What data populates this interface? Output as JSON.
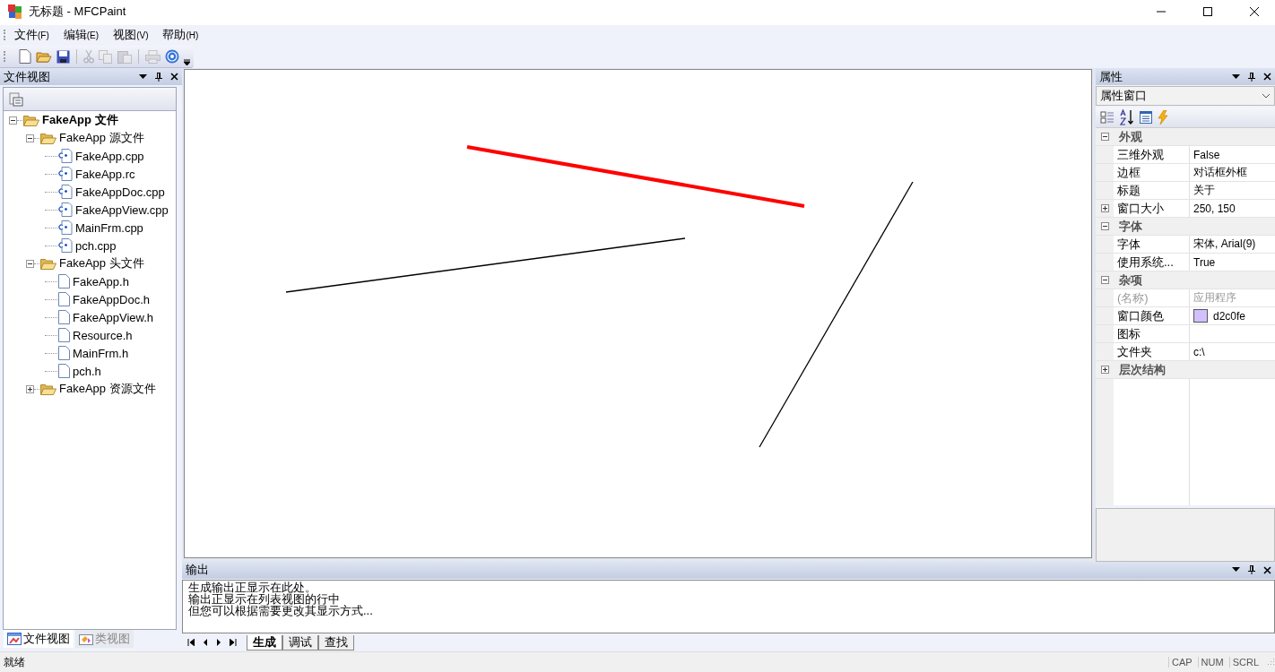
{
  "window": {
    "title": "无标题 - MFCPaint"
  },
  "menu": [
    {
      "label": "文件",
      "key": "(F)"
    },
    {
      "label": "编辑",
      "key": "(E)"
    },
    {
      "label": "视图",
      "key": "(V)"
    },
    {
      "label": "帮助",
      "key": "(H)"
    }
  ],
  "toolbar": [
    {
      "kind": "new",
      "disabled": false
    },
    {
      "kind": "open",
      "disabled": false
    },
    {
      "kind": "save",
      "disabled": false
    },
    {
      "kind": "cut",
      "disabled": true
    },
    {
      "kind": "copy",
      "disabled": true
    },
    {
      "kind": "paste",
      "disabled": true
    },
    {
      "kind": "print",
      "disabled": true
    },
    {
      "kind": "help",
      "disabled": false
    }
  ],
  "file_view": {
    "title": "文件视图",
    "tree": [
      {
        "label": "FakeApp 文件",
        "kind": "folder",
        "expanded": true,
        "children": [
          {
            "label": "FakeApp 源文件",
            "kind": "folder",
            "expanded": true,
            "children": [
              {
                "label": "FakeApp.cpp",
                "kind": "cpp"
              },
              {
                "label": "FakeApp.rc",
                "kind": "cpp"
              },
              {
                "label": "FakeAppDoc.cpp",
                "kind": "cpp"
              },
              {
                "label": "FakeAppView.cpp",
                "kind": "cpp"
              },
              {
                "label": "MainFrm.cpp",
                "kind": "cpp"
              },
              {
                "label": "pch.cpp",
                "kind": "cpp"
              }
            ]
          },
          {
            "label": "FakeApp 头文件",
            "kind": "folder",
            "expanded": true,
            "children": [
              {
                "label": "FakeApp.h",
                "kind": "h"
              },
              {
                "label": "FakeAppDoc.h",
                "kind": "h"
              },
              {
                "label": "FakeAppView.h",
                "kind": "h"
              },
              {
                "label": "Resource.h",
                "kind": "h"
              },
              {
                "label": "MainFrm.h",
                "kind": "h"
              },
              {
                "label": "pch.h",
                "kind": "h"
              }
            ]
          },
          {
            "label": "FakeApp 资源文件",
            "kind": "folder",
            "expanded": false
          }
        ]
      }
    ],
    "tabs": [
      {
        "label": "文件视图",
        "kind": "file",
        "selected": true
      },
      {
        "label": "类视图",
        "kind": "class",
        "selected": false
      }
    ]
  },
  "canvas": {
    "lines": [
      {
        "color": "#ff0000",
        "kind": "thick"
      },
      {
        "color": "#000000",
        "kind": "thin"
      },
      {
        "color": "#000000",
        "kind": "thin"
      }
    ]
  },
  "properties": {
    "title": "属性",
    "selector": "属性窗口",
    "groups": [
      {
        "name": "外观",
        "expanded": true,
        "items": [
          {
            "name": "三维外观",
            "value": "False",
            "disabled": false
          },
          {
            "name": "边框",
            "value": "对话框外框",
            "disabled": false
          },
          {
            "name": "标题",
            "value": "关于",
            "disabled": false
          },
          {
            "name": "窗口大小",
            "value": "250, 150",
            "disabled": false,
            "expanded": false
          }
        ]
      },
      {
        "name": "字体",
        "expanded": true,
        "items": [
          {
            "name": "字体",
            "value": "宋体, Arial(9)",
            "disabled": false
          },
          {
            "name": "使用系统...",
            "value": "True",
            "disabled": false
          }
        ]
      },
      {
        "name": "杂项",
        "expanded": true,
        "items": [
          {
            "name": "(名称)",
            "value": "应用程序",
            "disabled": true
          },
          {
            "name": "窗口颜色",
            "value": "d2c0fe",
            "disabled": false,
            "color": "#d2c0fe"
          },
          {
            "name": "图标",
            "disabled": false
          },
          {
            "name": "文件夹",
            "value": "c:\\",
            "disabled": false
          }
        ]
      },
      {
        "name": "层次结构",
        "expanded": false
      }
    ]
  },
  "output": {
    "title": "输出",
    "lines": [
      "生成输出正显示在此处。",
      "输出正显示在列表视图的行中",
      "但您可以根据需要更改其显示方式..."
    ],
    "tabs": [
      {
        "label": "生成",
        "selected": true
      },
      {
        "label": "调试",
        "selected": false
      },
      {
        "label": "查找",
        "selected": false
      }
    ]
  },
  "status_bar": {
    "text": "就绪",
    "indicators": [
      "CAP",
      "NUM",
      "SCRL"
    ]
  }
}
